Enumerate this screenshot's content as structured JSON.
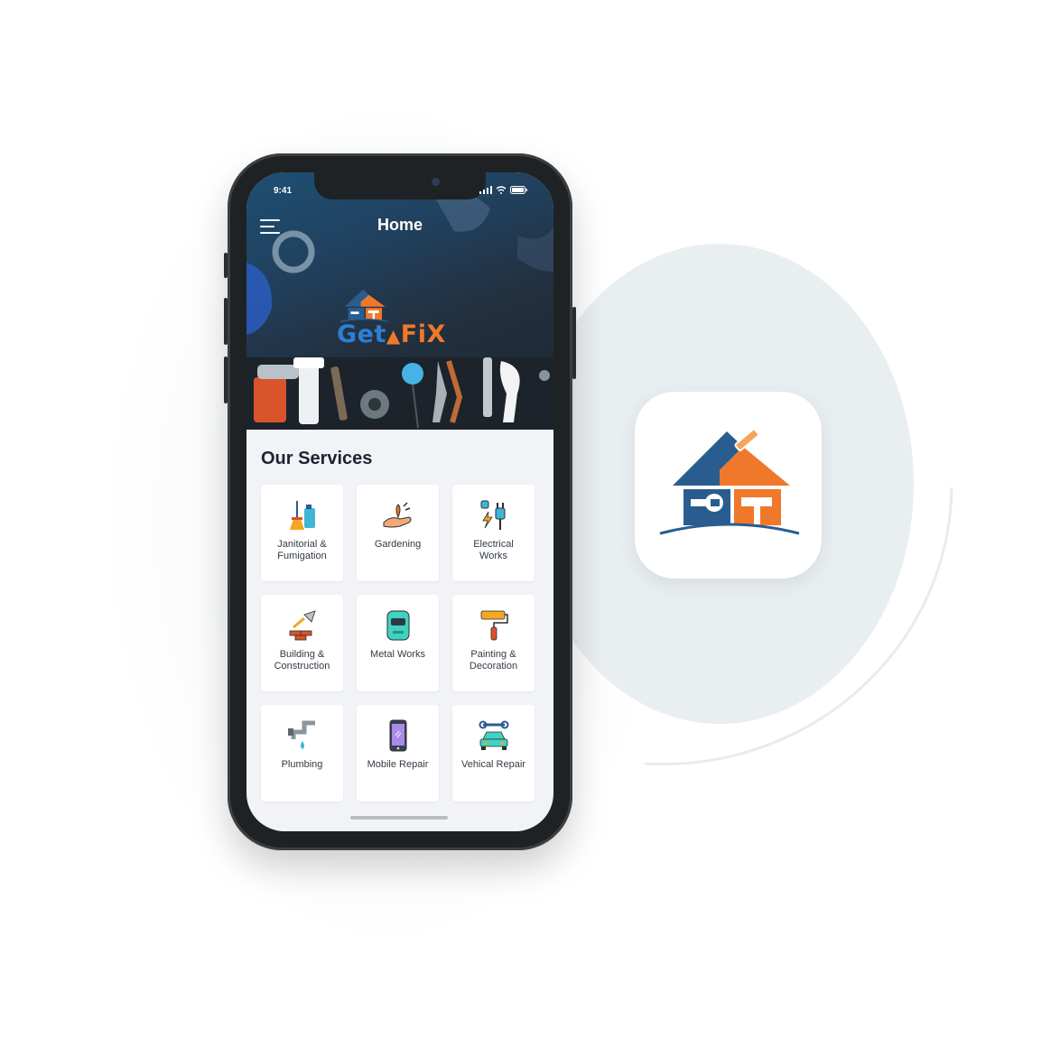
{
  "status_bar": {
    "time": "9:41"
  },
  "header": {
    "title": "Home",
    "menu_icon": "hamburger-icon"
  },
  "brand": {
    "part1": "Get",
    "part2": "FiX",
    "accent_orange": "#f0782a",
    "accent_blue": "#2c7fd1",
    "dark_blue": "#2a5d8f"
  },
  "services": {
    "title": "Our Services",
    "items": [
      {
        "label": "Janitorial &\nFumigation",
        "icon": "janitor-icon"
      },
      {
        "label": "Gardening",
        "icon": "gardening-icon"
      },
      {
        "label": "Electrical\nWorks",
        "icon": "electrical-plug-icon"
      },
      {
        "label": "Building &\nConstruction",
        "icon": "trowel-bricks-icon"
      },
      {
        "label": "Metal Works",
        "icon": "welding-mask-icon"
      },
      {
        "label": "Painting &\nDecoration",
        "icon": "paint-roller-icon"
      },
      {
        "label": "Plumbing",
        "icon": "water-tap-icon"
      },
      {
        "label": "Mobile Repair",
        "icon": "smartphone-icon"
      },
      {
        "label": "Vehical Repair",
        "icon": "car-wrench-icon"
      }
    ]
  },
  "app_icon": {
    "icon": "getafix-house-logo-icon"
  }
}
